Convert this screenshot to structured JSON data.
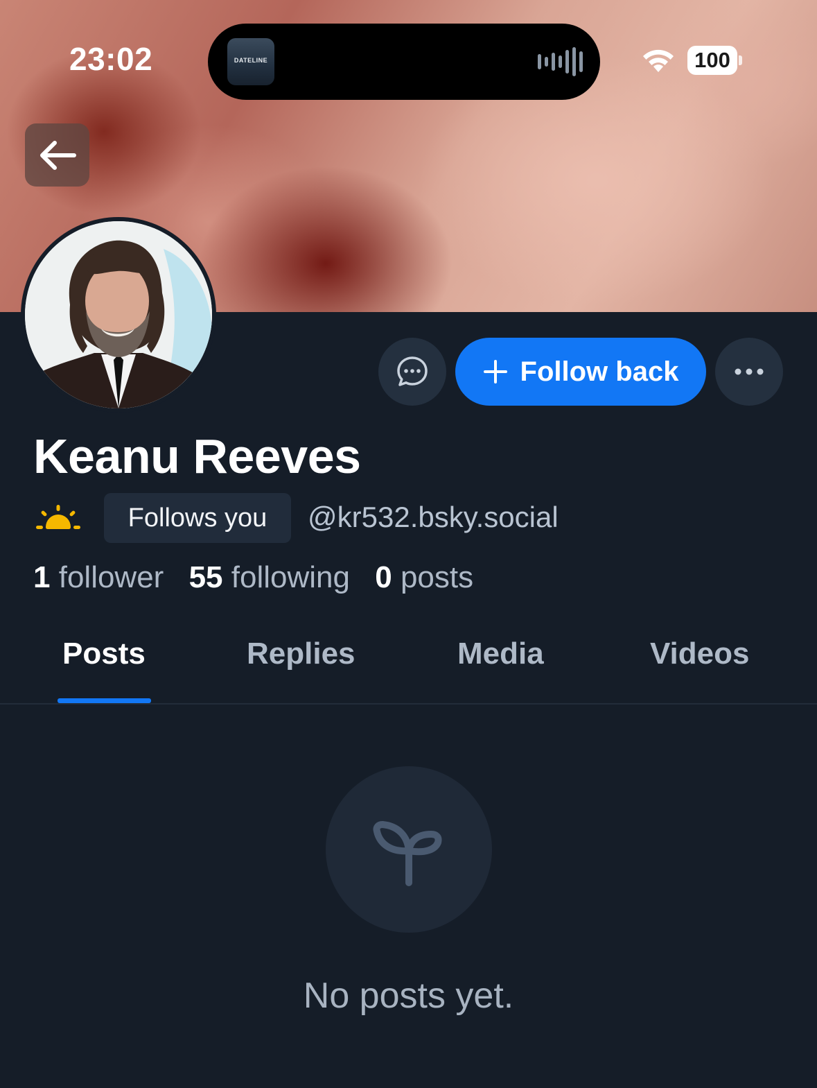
{
  "status_bar": {
    "time": "23:02",
    "now_playing_label": "DATELINE",
    "battery": "100"
  },
  "profile": {
    "display_name": "Keanu Reeves",
    "follows_you_label": "Follows you",
    "handle": "@kr532.bsky.social",
    "stats": {
      "followers_count": "1",
      "followers_label": "follower",
      "following_count": "55",
      "following_label": "following",
      "posts_count": "0",
      "posts_label": "posts"
    }
  },
  "actions": {
    "follow_back_label": "Follow back"
  },
  "tabs": [
    {
      "label": "Posts",
      "active": true
    },
    {
      "label": "Replies",
      "active": false
    },
    {
      "label": "Media",
      "active": false
    },
    {
      "label": "Videos",
      "active": false
    }
  ],
  "empty_state": {
    "message": "No posts yet."
  },
  "colors": {
    "background": "#151d28",
    "accent": "#1277f5",
    "badge_background": "#212c3b",
    "icon_button_background": "#24303f",
    "muted_text": "#aeb9c7",
    "sun_icon": "#f5b800"
  },
  "icons": {
    "back": "arrow-left-icon",
    "message": "chat-bubble-icon",
    "follow": "plus-icon",
    "more": "ellipsis-icon",
    "new_user": "sun-icon",
    "empty": "seedling-icon"
  }
}
